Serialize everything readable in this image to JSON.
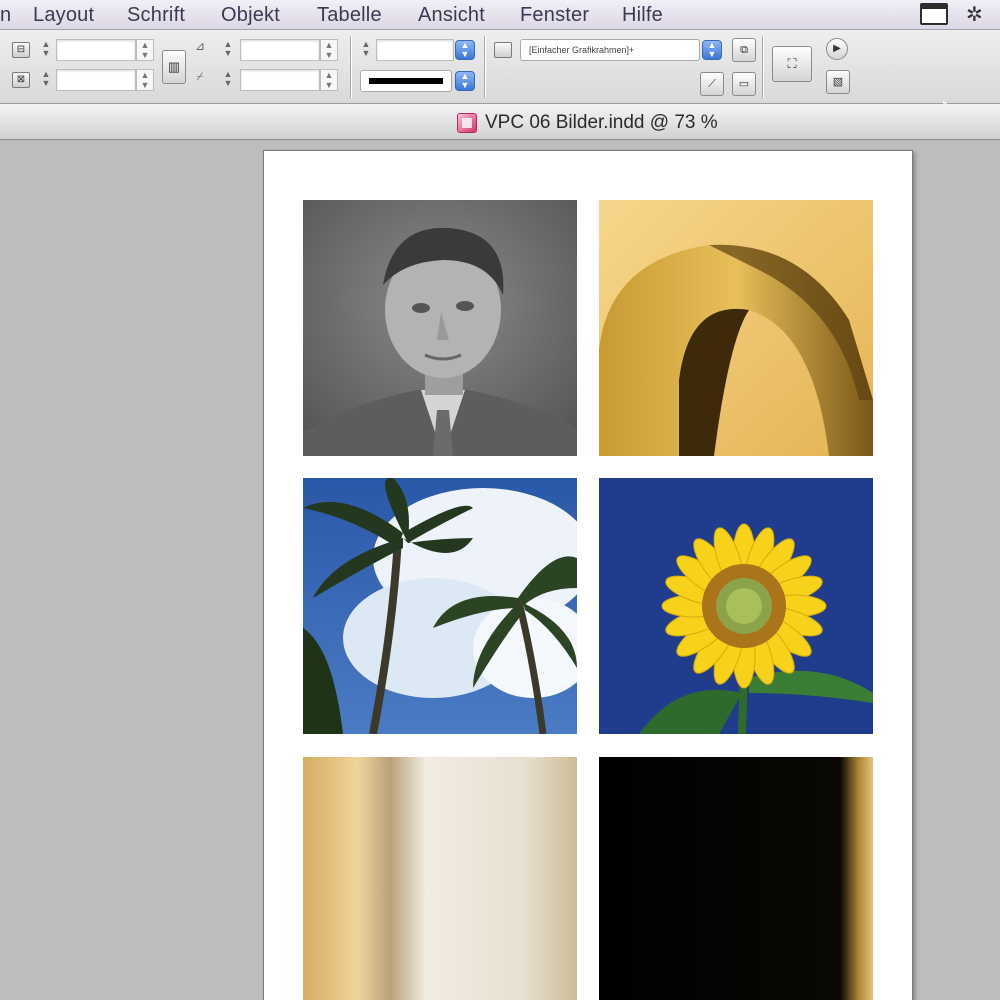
{
  "menubar": {
    "items": [
      "n",
      "Layout",
      "Schrift",
      "Objekt",
      "Tabelle",
      "Ansicht",
      "Fenster",
      "Hilfe"
    ]
  },
  "controlbar": {
    "object_style": "[Einfacher Grafikrahmen]+",
    "stroke_color": "#000000"
  },
  "document": {
    "title": "VPC 06 Bilder.indd @ 73 %"
  },
  "icons": [
    "window-icon",
    "gear-icon",
    "mouse-cursor-icon",
    "indesign-doc-icon"
  ],
  "colors": {
    "menu_text": "#3b3a52",
    "accent_blue": "#3a78d6",
    "pasteboard": "#bdbdbd"
  }
}
